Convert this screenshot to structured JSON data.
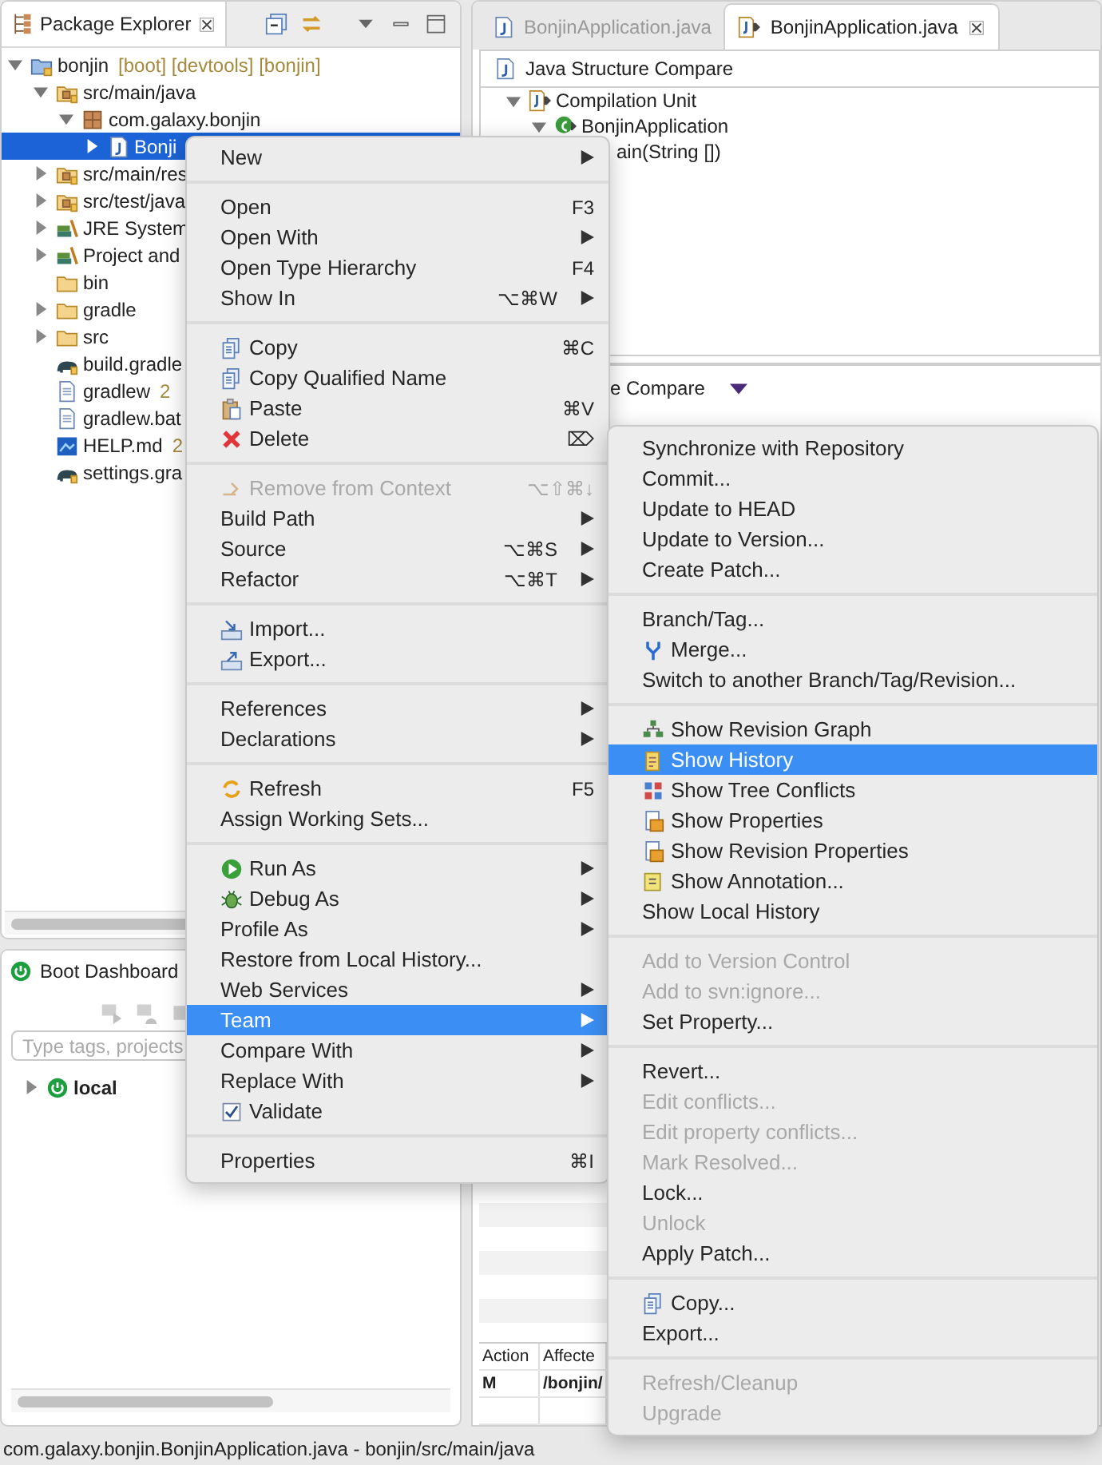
{
  "package_explorer": {
    "title": "Package Explorer",
    "tree": [
      {
        "label": "bonjin",
        "decoration": "[boot] [devtools] [bonjin]",
        "kind": "project",
        "expanded": true,
        "selected": false,
        "children": [
          {
            "label": "src/main/java",
            "kind": "source-folder",
            "expanded": true,
            "selected": false,
            "children": [
              {
                "label": "com.galaxy.bonjin",
                "kind": "package",
                "expanded": true,
                "selected": false,
                "children": [
                  {
                    "label": "Bonji",
                    "kind": "java-file",
                    "expanded": false,
                    "selected": true
                  }
                ]
              }
            ]
          },
          {
            "label": "src/main/res",
            "kind": "source-folder",
            "expanded": false,
            "selected": false
          },
          {
            "label": "src/test/java",
            "kind": "source-folder",
            "expanded": false,
            "selected": false
          },
          {
            "label": "JRE System",
            "kind": "library",
            "expanded": false,
            "selected": false
          },
          {
            "label": "Project and",
            "kind": "library",
            "expanded": false,
            "selected": false
          },
          {
            "label": "bin",
            "kind": "folder",
            "selected": false
          },
          {
            "label": "gradle",
            "kind": "folder",
            "expanded": false,
            "selected": false
          },
          {
            "label": "src",
            "kind": "folder",
            "expanded": false,
            "selected": false
          },
          {
            "label": "build.gradle",
            "kind": "gradle",
            "selected": false
          },
          {
            "label": "gradlew",
            "decoration": "2",
            "kind": "text-file",
            "selected": false
          },
          {
            "label": "gradlew.bat",
            "kind": "text-file",
            "selected": false
          },
          {
            "label": "HELP.md",
            "decoration": "2",
            "kind": "markdown",
            "selected": false
          },
          {
            "label": "settings.gra",
            "kind": "gradle",
            "selected": false
          }
        ]
      }
    ]
  },
  "boot_dashboard": {
    "title": "Boot Dashboard",
    "search": {
      "placeholder": "Type tags, projects"
    },
    "tree": [
      {
        "label": "local",
        "expanded": false
      }
    ]
  },
  "editor": {
    "tabs": [
      {
        "label": "BonjinApplication.java",
        "selected": false
      },
      {
        "label": "BonjinApplication.java",
        "selected": true
      }
    ],
    "compare_title": "Java Structure Compare",
    "compare_tree": [
      {
        "label": "Compilation Unit",
        "kind": "compilation-unit",
        "expanded": true,
        "selected": false,
        "children": [
          {
            "label": "BonjinApplication",
            "kind": "class",
            "expanded": true,
            "selected": false,
            "children": [
              {
                "label": "ain(String [])",
                "selected": false
              }
            ]
          }
        ]
      }
    ],
    "lower_title": "e Compare",
    "changes_table": {
      "columns": [
        "Action",
        "Affecte"
      ],
      "rows": [
        [
          "M",
          "/bonjin/"
        ]
      ]
    }
  },
  "context_menu": {
    "items": [
      {
        "kind": "item",
        "label": "New",
        "submenu": true,
        "disabled": false,
        "selected": false
      },
      {
        "kind": "separator"
      },
      {
        "kind": "item",
        "label": "Open",
        "shortcut": "F3",
        "submenu": false,
        "disabled": false,
        "selected": false
      },
      {
        "kind": "item",
        "label": "Open With",
        "submenu": true,
        "disabled": false,
        "selected": false
      },
      {
        "kind": "item",
        "label": "Open Type Hierarchy",
        "shortcut": "F4",
        "submenu": false,
        "disabled": false,
        "selected": false
      },
      {
        "kind": "item",
        "label": "Show In",
        "shortcut": "⌥⌘W",
        "submenu": true,
        "disabled": false,
        "selected": false
      },
      {
        "kind": "separator"
      },
      {
        "kind": "copy",
        "label": "Copy",
        "shortcut": "⌘C",
        "submenu": false,
        "disabled": false,
        "selected": false
      },
      {
        "kind": "copy",
        "label": "Copy Qualified Name",
        "submenu": false,
        "disabled": false,
        "selected": false
      },
      {
        "kind": "paste",
        "label": "Paste",
        "shortcut": "⌘V",
        "submenu": false,
        "disabled": false,
        "selected": false
      },
      {
        "kind": "delete",
        "label": "Delete",
        "shortcut": "⌦",
        "submenu": false,
        "disabled": false,
        "selected": false
      },
      {
        "kind": "separator"
      },
      {
        "kind": "context",
        "label": "Remove from Context",
        "shortcut": "⌥⇧⌘↓",
        "submenu": false,
        "disabled": true,
        "selected": false
      },
      {
        "kind": "item",
        "label": "Build Path",
        "submenu": true,
        "disabled": false,
        "selected": false
      },
      {
        "kind": "item",
        "label": "Source",
        "shortcut": "⌥⌘S",
        "submenu": true,
        "disabled": false,
        "selected": false
      },
      {
        "kind": "item",
        "label": "Refactor",
        "shortcut": "⌥⌘T",
        "submenu": true,
        "disabled": false,
        "selected": false
      },
      {
        "kind": "separator"
      },
      {
        "kind": "import",
        "label": "Import...",
        "submenu": false,
        "disabled": false,
        "selected": false
      },
      {
        "kind": "export",
        "label": "Export...",
        "submenu": false,
        "disabled": false,
        "selected": false
      },
      {
        "kind": "separator"
      },
      {
        "kind": "item",
        "label": "References",
        "submenu": true,
        "disabled": false,
        "selected": false
      },
      {
        "kind": "item",
        "label": "Declarations",
        "submenu": true,
        "disabled": false,
        "selected": false
      },
      {
        "kind": "separator"
      },
      {
        "kind": "refresh",
        "label": "Refresh",
        "shortcut": "F5",
        "submenu": false,
        "disabled": false,
        "selected": false
      },
      {
        "kind": "item",
        "label": "Assign Working Sets...",
        "submenu": false,
        "disabled": false,
        "selected": false
      },
      {
        "kind": "separator"
      },
      {
        "kind": "run",
        "label": "Run As",
        "submenu": true,
        "disabled": false,
        "selected": false
      },
      {
        "kind": "debug",
        "label": "Debug As",
        "submenu": true,
        "disabled": false,
        "selected": false
      },
      {
        "kind": "item",
        "label": "Profile As",
        "submenu": true,
        "disabled": false,
        "selected": false
      },
      {
        "kind": "item",
        "label": "Restore from Local History...",
        "submenu": false,
        "disabled": false,
        "selected": false
      },
      {
        "kind": "item",
        "label": "Web Services",
        "submenu": true,
        "disabled": false,
        "selected": false
      },
      {
        "kind": "item",
        "label": "Team",
        "submenu": true,
        "disabled": false,
        "selected": true
      },
      {
        "kind": "item",
        "label": "Compare With",
        "submenu": true,
        "disabled": false,
        "selected": false
      },
      {
        "kind": "item",
        "label": "Replace With",
        "submenu": true,
        "disabled": false,
        "selected": false
      },
      {
        "kind": "check",
        "label": "Validate",
        "checked": true,
        "submenu": false,
        "disabled": false,
        "selected": false
      },
      {
        "kind": "separator"
      },
      {
        "kind": "item",
        "label": "Properties",
        "shortcut": "⌘I",
        "submenu": false,
        "disabled": false,
        "selected": false
      }
    ]
  },
  "team_submenu": {
    "items": [
      {
        "kind": "item",
        "label": "Synchronize with Repository",
        "disabled": false,
        "selected": false
      },
      {
        "kind": "item",
        "label": "Commit...",
        "disabled": false,
        "selected": false
      },
      {
        "kind": "item",
        "label": "Update to HEAD",
        "disabled": false,
        "selected": false
      },
      {
        "kind": "item",
        "label": "Update to Version...",
        "disabled": false,
        "selected": false
      },
      {
        "kind": "item",
        "label": "Create Patch...",
        "disabled": false,
        "selected": false
      },
      {
        "kind": "separator"
      },
      {
        "kind": "item",
        "label": "Branch/Tag...",
        "disabled": false,
        "selected": false
      },
      {
        "kind": "merge",
        "label": "Merge...",
        "disabled": false,
        "selected": false
      },
      {
        "kind": "item",
        "label": "Switch to another Branch/Tag/Revision...",
        "disabled": false,
        "selected": false
      },
      {
        "kind": "separator"
      },
      {
        "kind": "graph",
        "label": "Show Revision Graph",
        "disabled": false,
        "selected": false
      },
      {
        "kind": "history",
        "label": "Show History",
        "disabled": false,
        "selected": true
      },
      {
        "kind": "conflicts",
        "label": "Show Tree Conflicts",
        "disabled": false,
        "selected": false
      },
      {
        "kind": "properties",
        "label": "Show Properties",
        "disabled": false,
        "selected": false
      },
      {
        "kind": "properties",
        "label": "Show Revision Properties",
        "disabled": false,
        "selected": false
      },
      {
        "kind": "annotation",
        "label": "Show Annotation...",
        "disabled": false,
        "selected": false
      },
      {
        "kind": "item",
        "label": "Show Local History",
        "disabled": false,
        "selected": false
      },
      {
        "kind": "separator"
      },
      {
        "kind": "item",
        "label": "Add to Version Control",
        "disabled": true,
        "selected": false
      },
      {
        "kind": "item",
        "label": "Add to svn:ignore...",
        "disabled": true,
        "selected": false
      },
      {
        "kind": "item",
        "label": "Set Property...",
        "disabled": false,
        "selected": false
      },
      {
        "kind": "separator"
      },
      {
        "kind": "item",
        "label": "Revert...",
        "disabled": false,
        "selected": false
      },
      {
        "kind": "item",
        "label": "Edit conflicts...",
        "disabled": true,
        "selected": false
      },
      {
        "kind": "item",
        "label": "Edit property conflicts...",
        "disabled": true,
        "selected": false
      },
      {
        "kind": "item",
        "label": "Mark Resolved...",
        "disabled": true,
        "selected": false
      },
      {
        "kind": "item",
        "label": "Lock...",
        "disabled": false,
        "selected": false
      },
      {
        "kind": "item",
        "label": "Unlock",
        "disabled": true,
        "selected": false
      },
      {
        "kind": "item",
        "label": "Apply Patch...",
        "disabled": false,
        "selected": false
      },
      {
        "kind": "separator"
      },
      {
        "kind": "copy",
        "label": "Copy...",
        "disabled": false,
        "selected": false
      },
      {
        "kind": "item",
        "label": "Export...",
        "disabled": false,
        "selected": false
      },
      {
        "kind": "separator"
      },
      {
        "kind": "item",
        "label": "Refresh/Cleanup",
        "disabled": true,
        "selected": false
      },
      {
        "kind": "item",
        "label": "Upgrade",
        "disabled": true,
        "selected": false
      }
    ]
  },
  "status_bar": "com.galaxy.bonjin.BonjinApplication.java - bonjin/src/main/java"
}
